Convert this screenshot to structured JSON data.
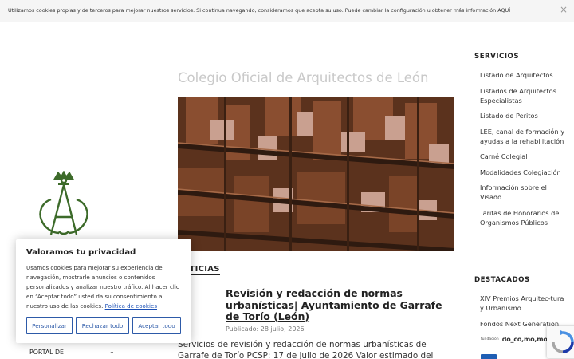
{
  "cookie_bar": {
    "text": "Utilizamos cookies propias y de terceros para mejorar nuestros servicios. Si continua navegando, consideramos que acepta su uso. Puede cambiar la configuración u obtener más información ",
    "link": "AQUÍ",
    "close_icon": "close-icon"
  },
  "site": {
    "title": "Colegio Oficial de Arquitectos de León"
  },
  "news": {
    "heading": "NOTICIAS",
    "post": {
      "title": "Revisión y redacción de normas urbanísticas| Ayuntamiento de Garrafe de Torío (León)",
      "date": "Publicado: 28 julio, 2026",
      "excerpt": "Servicios de revisión y redacción de normas urbanísticas de Garrafe de Torío PCSP: 17 de julio de 2026 Valor estimado del contrato:"
    }
  },
  "sidebar": {
    "servicios_heading": "SERVICIOS",
    "servicios": [
      "Listado de Arquitectos",
      "Listados de Arquitectos Especialistas",
      "Listado de Peritos",
      "LEE, canal de formación y ayudas a la rehabilitación",
      "Carné Colegial",
      "Modalidades Colegiación",
      "Información sobre el Visado",
      "Tarifas de Honorarios de Organismos Públicos"
    ],
    "destacados_heading": "DESTACADOS",
    "destacados": [
      "XIV Premios Arquitec-tura y Urbanismo",
      "Fondos Next Generation"
    ],
    "sponsor_small": "fundación",
    "sponsor_name": "do_co,mo,mo_"
  },
  "privacy": {
    "title": "Valoramos tu privacidad",
    "text": "Usamos cookies para mejorar su experiencia de navegación, mostrarle anuncios o contenidos personalizados y analizar nuestro tráfico. Al hacer clic en “Aceptar todo” usted da su consentimiento a nuestro uso de las cookies.",
    "link": "Política de cookies",
    "buttons": {
      "customize": "Personalizar",
      "reject": "Rechazar todo",
      "accept": "Aceptar todo"
    }
  },
  "menu": {
    "portal": "PORTAL DE"
  },
  "colors": {
    "accent": "#2d5aa8",
    "logo_green": "#3d6b2a",
    "hero_rust": "#6a3a22"
  }
}
